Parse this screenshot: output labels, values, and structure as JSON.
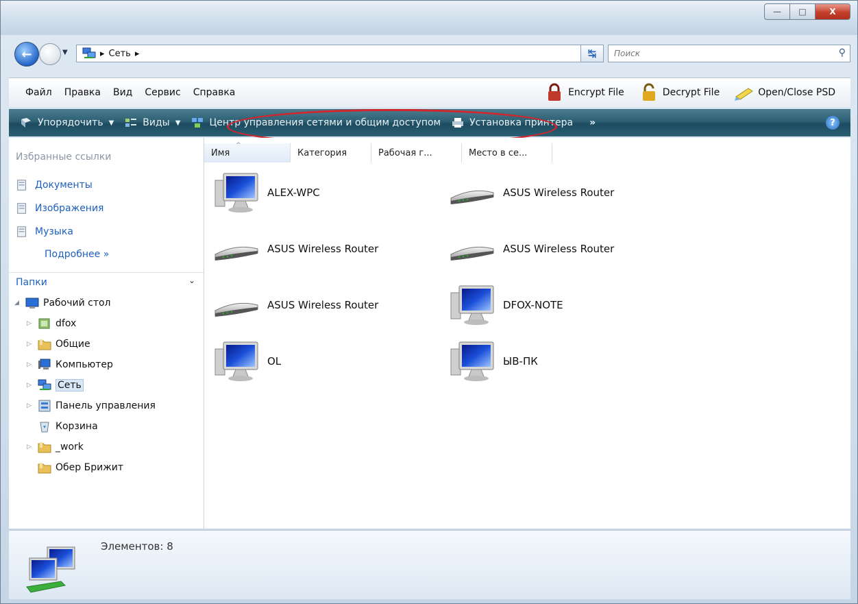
{
  "window": {
    "caption_buttons": {
      "minimize": "—",
      "maximize": "□",
      "close": "X"
    }
  },
  "address": {
    "crumb": "Сеть",
    "search_placeholder": "Поиск"
  },
  "menu": {
    "items": [
      "Файл",
      "Правка",
      "Вид",
      "Сервис",
      "Справка"
    ],
    "plugins": [
      {
        "label": "Encrypt File",
        "icon": "lock-red-icon"
      },
      {
        "label": "Decrypt File",
        "icon": "lock-gold-icon"
      },
      {
        "label": "Open/Close PSD",
        "icon": "pen-icon"
      }
    ]
  },
  "commands": {
    "organize": "Упорядочить",
    "views": "Виды",
    "network_center": "Центр управления сетями и общим доступом",
    "add_printer": "Установка принтера",
    "more": "»"
  },
  "favorites": {
    "title": "Избранные ссылки",
    "items": [
      "Документы",
      "Изображения",
      "Музыка"
    ],
    "more": "Подробнее  »"
  },
  "folders": {
    "title": "Папки",
    "tree": [
      "Рабочий стол",
      "dfox",
      "Общие",
      "Компьютер",
      "Сеть",
      "Панель управления",
      "Корзина",
      "_work",
      "Обер Брижит"
    ]
  },
  "columns": [
    "Имя",
    "Категория",
    "Рабочая г...",
    "Место в се..."
  ],
  "items": [
    {
      "label": "ALEX-WPC",
      "icon": "computer-icon"
    },
    {
      "label": "ASUS Wireless Router",
      "icon": "router-icon"
    },
    {
      "label": "ASUS Wireless Router",
      "icon": "router-icon"
    },
    {
      "label": "ASUS Wireless Router",
      "icon": "router-icon"
    },
    {
      "label": "ASUS Wireless Router",
      "icon": "router-icon"
    },
    {
      "label": "DFOX-NOTE",
      "icon": "computer-icon"
    },
    {
      "label": "OL",
      "icon": "computer-icon"
    },
    {
      "label": "ЫВ-ПК",
      "icon": "computer-icon"
    }
  ],
  "details": {
    "count_text": "Элементов: 8"
  },
  "colors": {
    "command_bar": "#2d5f73",
    "link_blue": "#1d5fbf",
    "highlight_red": "#d3262c"
  }
}
